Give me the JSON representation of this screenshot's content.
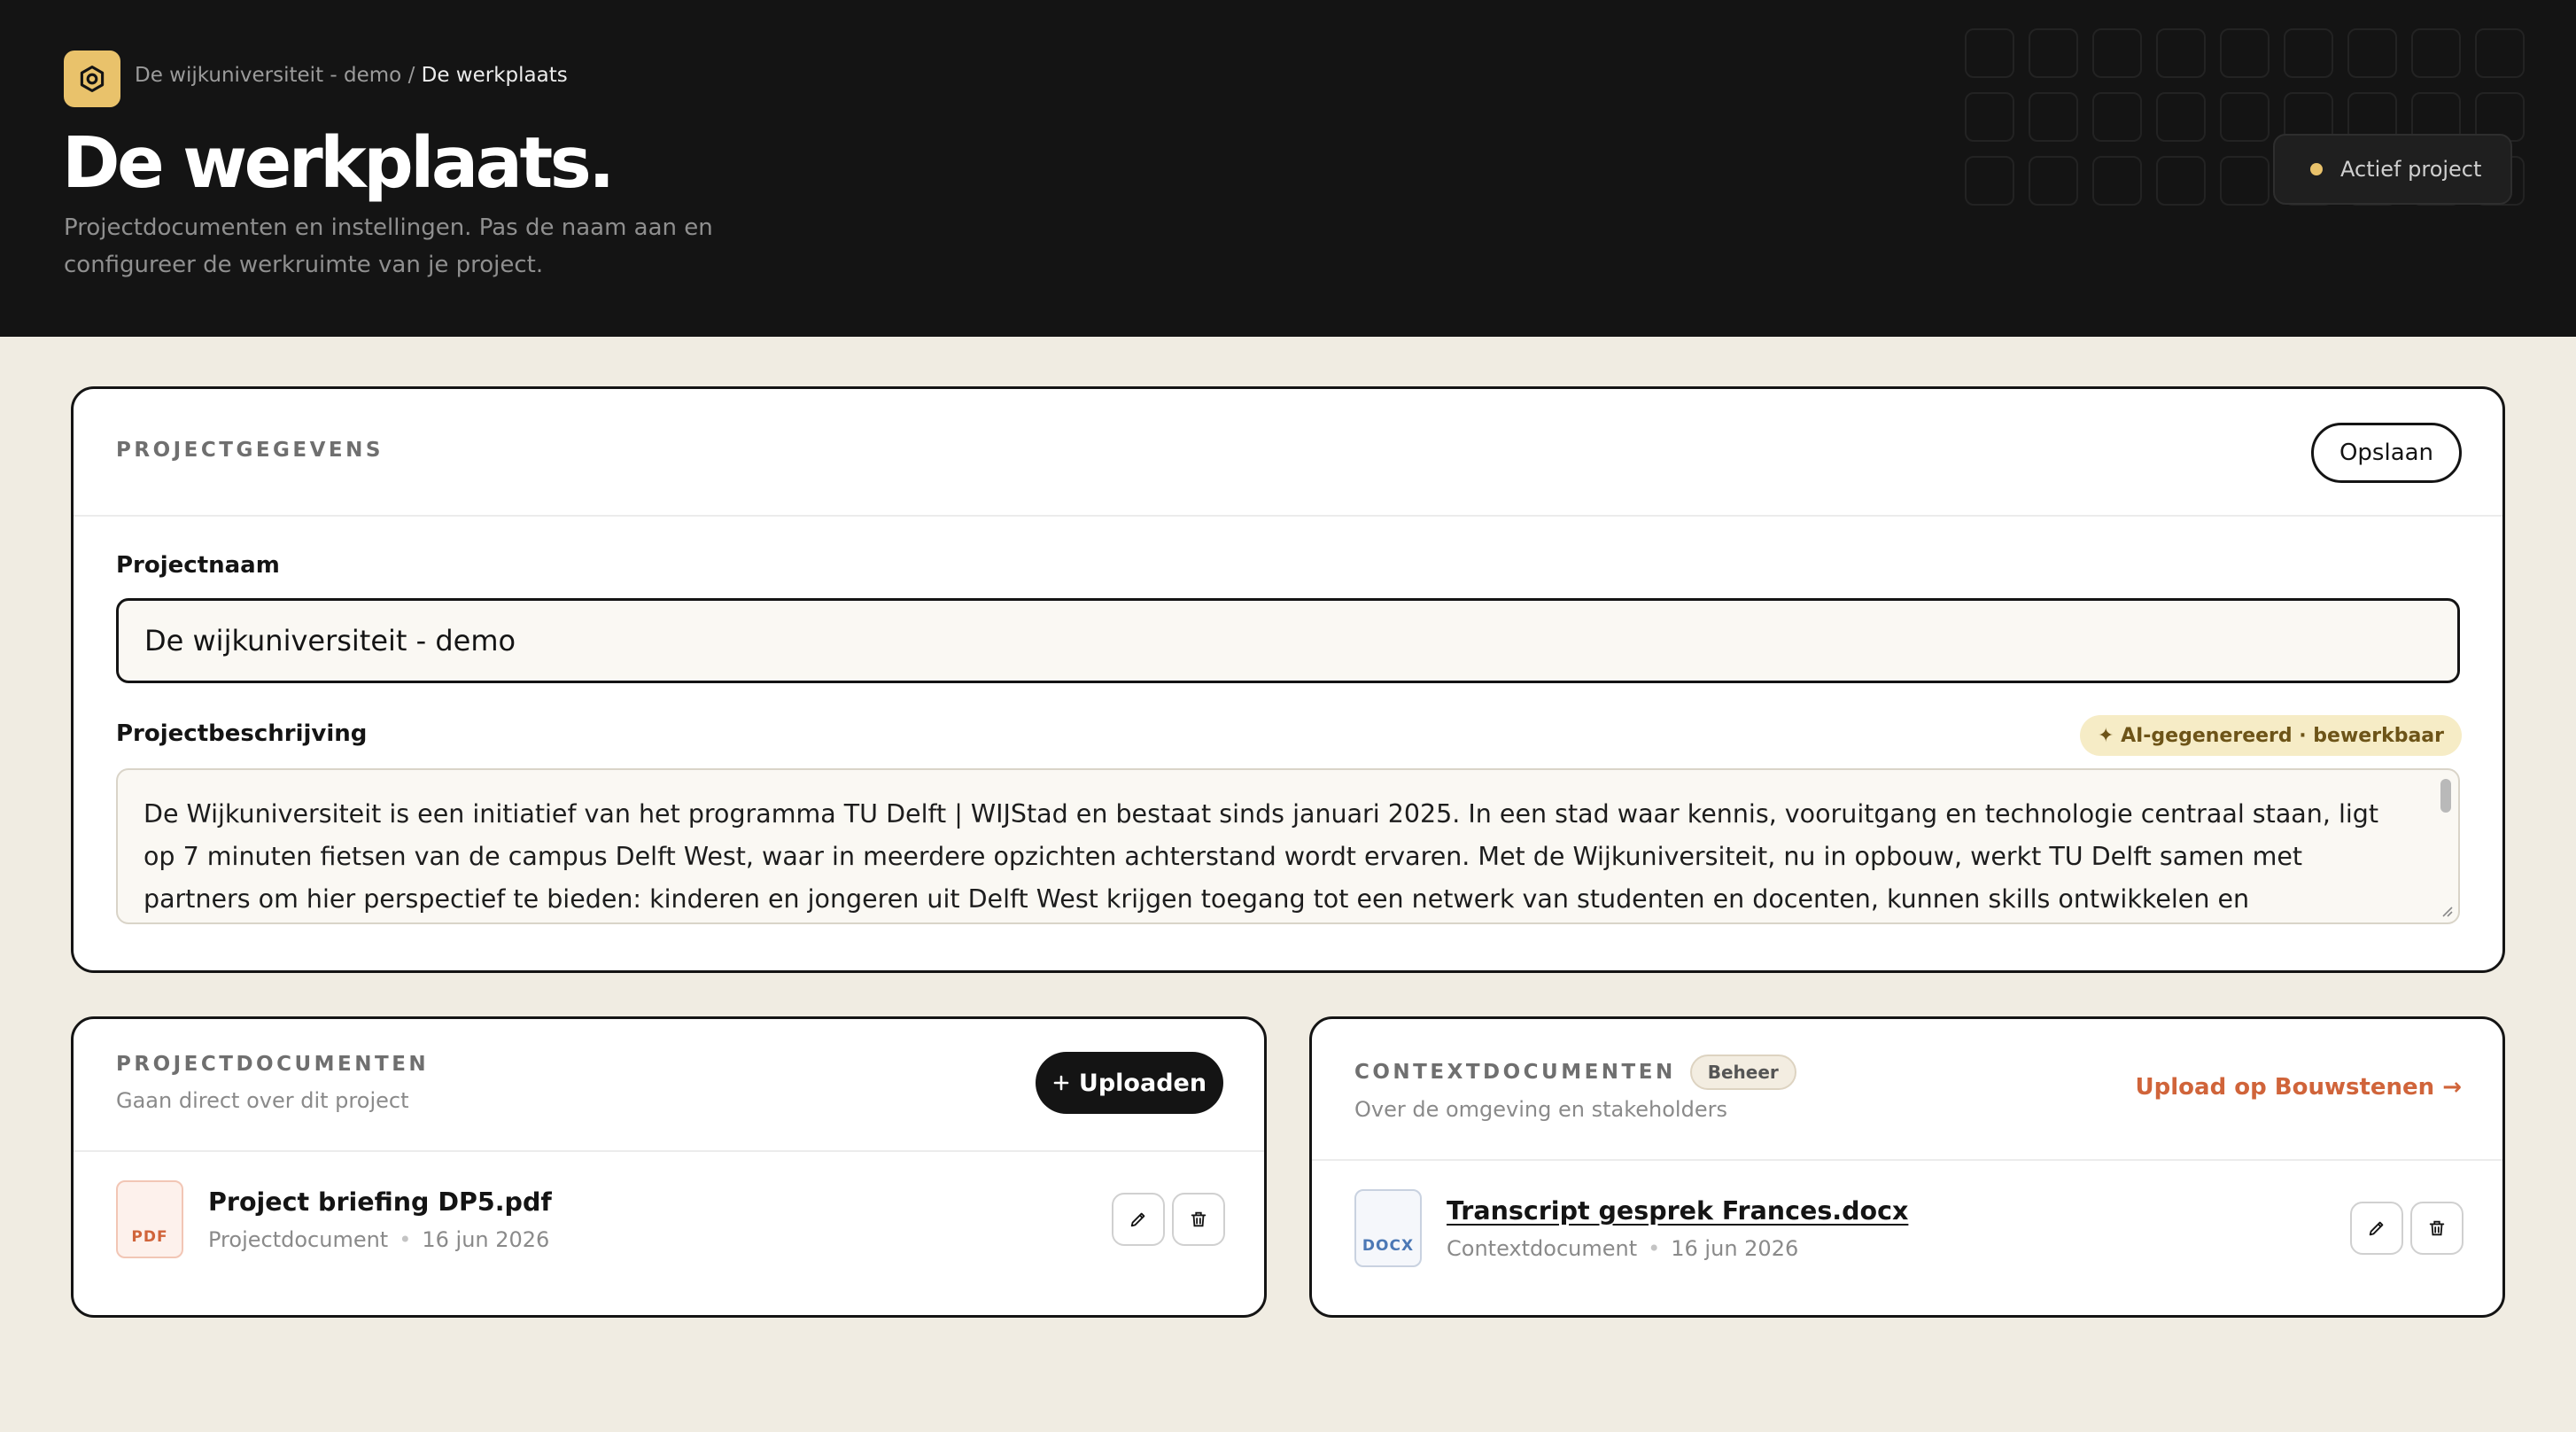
{
  "header": {
    "breadcrumb_parent": "De wijkuniversiteit - demo",
    "breadcrumb_separator": "/",
    "breadcrumb_current": "De werkplaats",
    "title": "De werkplaats.",
    "subtitle": "Projectdocumenten en instellingen. Pas de naam aan en configureer de werkruimte van je project.",
    "status_label": "Actief project",
    "logo_icon": "gear-icon"
  },
  "project": {
    "section_label": "PROJECTGEGEVENS",
    "save_label": "Opslaan",
    "name_label": "Projectnaam",
    "name_value": "De wijkuniversiteit - demo",
    "description_label": "Projectbeschrijving",
    "ai_badge": "✦ AI-gegenereerd · bewerkbaar",
    "description_value": "De Wijkuniversiteit is een initiatief van het programma TU Delft | WIJStad en bestaat sinds januari 2025. In een stad waar kennis, vooruitgang en technologie centraal staan, ligt op 7 minuten fietsen van de campus Delft West, waar in meerdere opzichten achterstand wordt ervaren. Met de Wijkuniversiteit, nu in opbouw, werkt TU Delft samen met partners om hier perspectief te bieden: kinderen en jongeren uit Delft West krijgen toegang tot een netwerk van studenten en docenten, kunnen skills ontwikkelen en kennismaken met de nieuwste technologieën; bewoners"
  },
  "project_documents": {
    "section_label": "PROJECTDOCUMENTEN",
    "subtitle": "Gaan direct over dit project",
    "upload_label": "Uploaden",
    "upload_icon": "plus-icon",
    "files": [
      {
        "type": "PDF",
        "name": "Project briefing DP5.pdf",
        "category": "Projectdocument",
        "date": "16 jun 2026"
      }
    ]
  },
  "context_documents": {
    "section_label": "CONTEXTDOCUMENTEN",
    "badge": "Beheer",
    "subtitle": "Over de omgeving en stakeholders",
    "upload_link": "Upload op Bouwstenen →",
    "files": [
      {
        "type": "DOCX",
        "name": "Transcript gesprek Frances.docx",
        "category": "Contextdocument",
        "date": "16 jun 2026"
      }
    ]
  },
  "colors": {
    "header_bg": "#141414",
    "page_bg": "#f0ece2",
    "accent_gold": "#e9c26b",
    "accent_orange": "#d0643a",
    "ai_badge_bg": "#f6ecc6"
  }
}
